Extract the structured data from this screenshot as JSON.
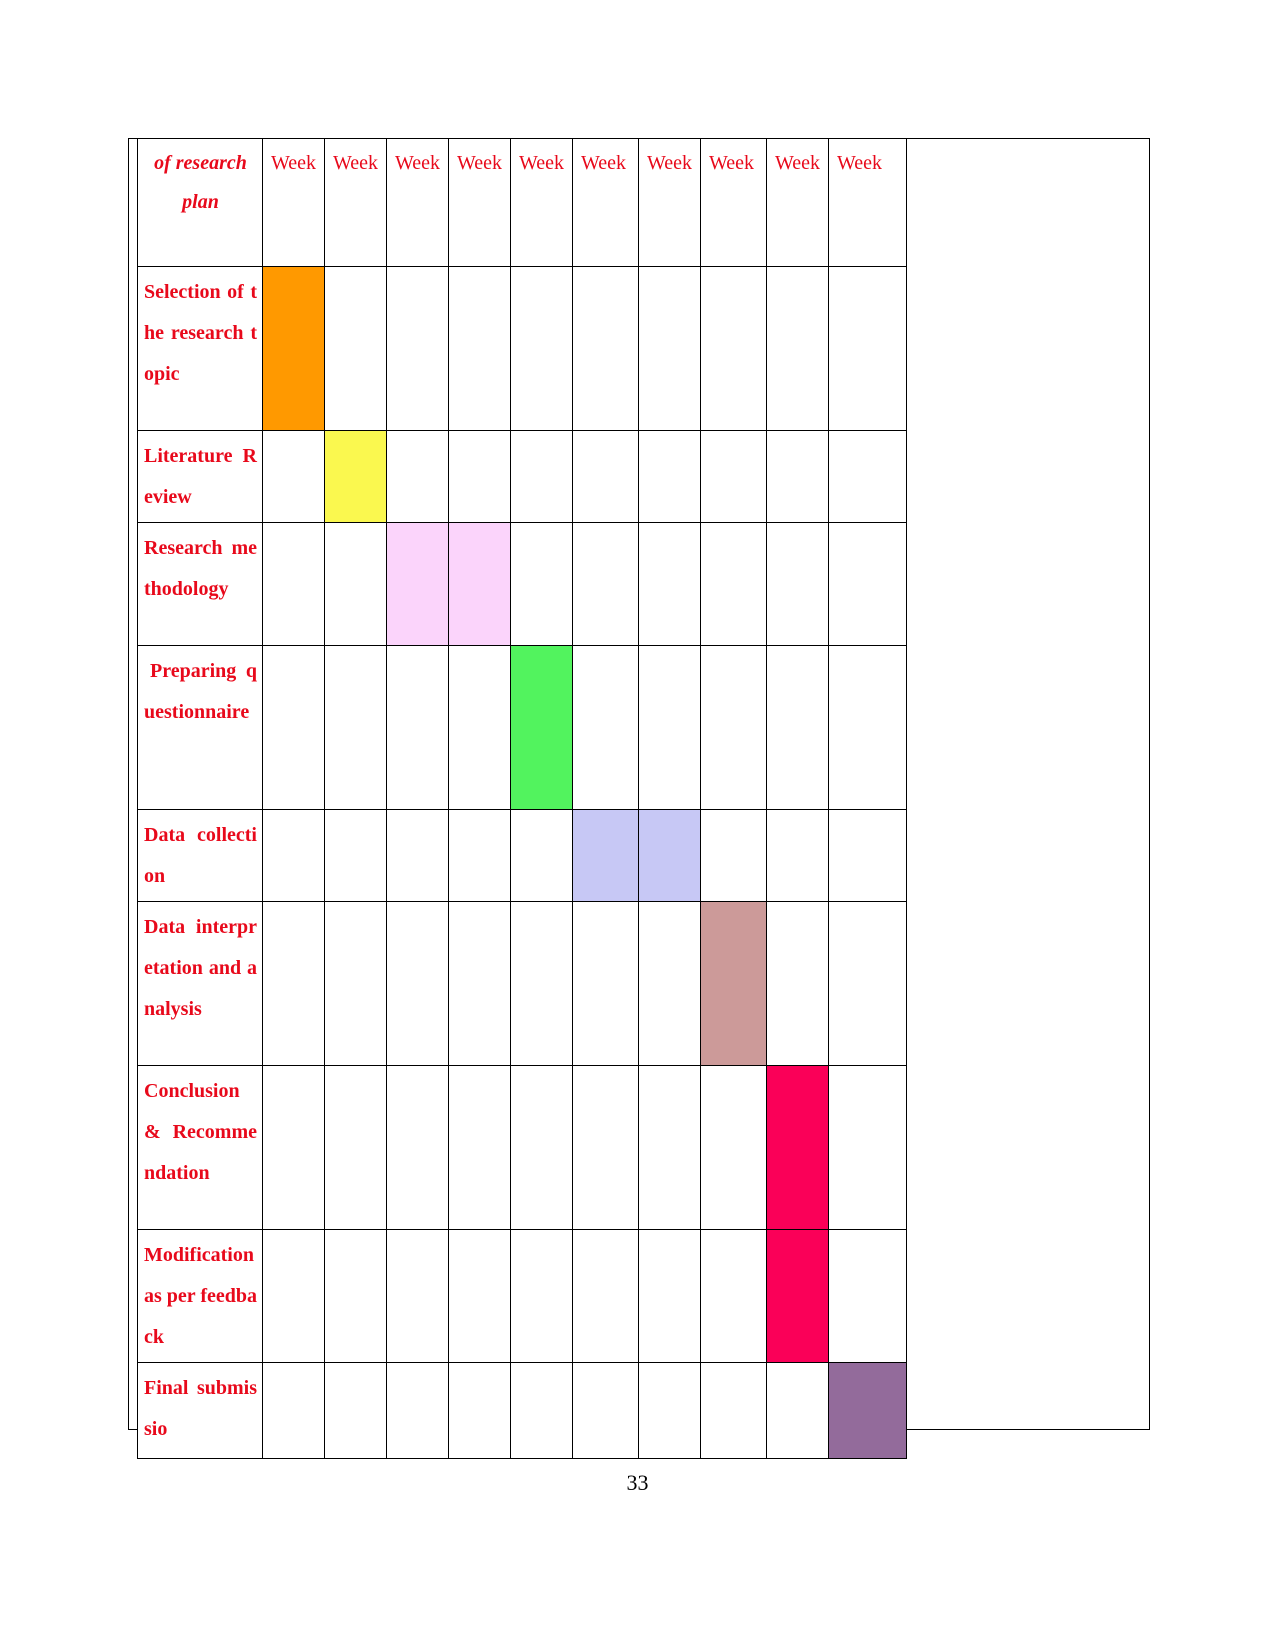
{
  "page": {
    "number": "33",
    "text_color": "#E8091B",
    "border_color": "#000000"
  },
  "chart_data": {
    "type": "table",
    "title": "of research plan",
    "subtitle": "",
    "xlabel": "",
    "ylabel": "",
    "legend_position": "none",
    "grid": true,
    "categories": [
      "Week",
      "Week",
      "Week",
      "Week",
      "Week",
      "Week",
      "Week",
      "Week",
      "Week",
      "Week"
    ],
    "column_headers": [
      {
        "label": "of research plan",
        "key": "task"
      },
      {
        "label": "Week",
        "key": "w1"
      },
      {
        "label": "Week",
        "key": "w2"
      },
      {
        "label": "Week",
        "key": "w3"
      },
      {
        "label": "Week",
        "key": "w4"
      },
      {
        "label": "Week",
        "key": "w5"
      },
      {
        "label": "Week",
        "key": "w6"
      },
      {
        "label": "Week",
        "key": "w7"
      },
      {
        "label": "Week",
        "key": "w8"
      },
      {
        "label": "Week",
        "key": "w9"
      },
      {
        "label": "Week",
        "key": "w10"
      }
    ],
    "rows": [
      {
        "task": "Selection of the research topic",
        "filled_weeks": [
          1
        ],
        "color": "#FF9900"
      },
      {
        "task": "Literature Review",
        "filled_weeks": [
          2
        ],
        "color": "#FAF84F"
      },
      {
        "task": "Research methodology",
        "filled_weeks": [
          3,
          4
        ],
        "color": "#FBD4FB"
      },
      {
        "task": " Preparing questionnaire",
        "filled_weeks": [
          5
        ],
        "color": "#52F35E"
      },
      {
        "task": "Data collection",
        "filled_weeks": [
          6,
          7
        ],
        "color": "#C7C8F5"
      },
      {
        "task": "Data interpretation and analysis",
        "filled_weeks": [
          8
        ],
        "color": "#CC9A99"
      },
      {
        "task": "Conclusion & Recommendation",
        "filled_weeks": [
          9
        ],
        "color": "#FA0058"
      },
      {
        "task": "Modification as per feedback",
        "filled_weeks": [
          9
        ],
        "color": "#FA0058"
      },
      {
        "task": "Final submissio",
        "filled_weeks": [
          10
        ],
        "color": "#936B9B"
      }
    ]
  }
}
